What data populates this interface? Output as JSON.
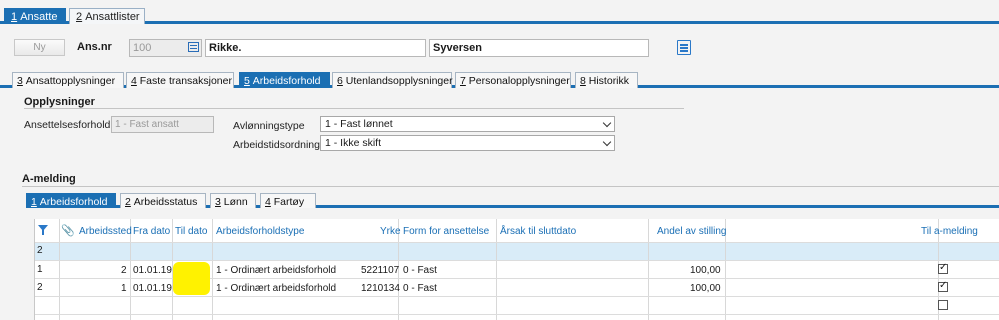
{
  "top_tabs": [
    {
      "key": "1",
      "label": "Ansatte"
    },
    {
      "key": "2",
      "label": "Ansattlister"
    }
  ],
  "header": {
    "new_button": "Ny",
    "ansnr_label": "Ans.nr",
    "ansnr_value": "100",
    "first_name": "Rikke.",
    "last_name": "Syversen"
  },
  "sub_tabs": [
    {
      "key": "3",
      "label": "Ansattopplysninger"
    },
    {
      "key": "4",
      "label": "Faste transaksjoner"
    },
    {
      "key": "5",
      "label": "Arbeidsforhold"
    },
    {
      "key": "6",
      "label": "Utenlandsopplysninger"
    },
    {
      "key": "7",
      "label": "Personalopplysninger"
    },
    {
      "key": "8",
      "label": "Historikk"
    }
  ],
  "opplysninger": {
    "title": "Opplysninger",
    "ansettelsesforhold_label": "Ansettelsesforhold",
    "ansettelsesforhold_value": "1 - Fast ansatt",
    "avlonningstype_label": "Avlønningstype",
    "avlonningstype_value": "1 - Fast lønnet",
    "arbeidstidsordning_label": "Arbeidstidsordning",
    "arbeidstidsordning_value": "1 - Ikke skift"
  },
  "amelding": {
    "title": "A-melding",
    "tabs": [
      {
        "key": "1",
        "label": "Arbeidsforhold"
      },
      {
        "key": "2",
        "label": "Arbeidsstatus"
      },
      {
        "key": "3",
        "label": "Lønn"
      },
      {
        "key": "4",
        "label": "Fartøy"
      }
    ],
    "columns": {
      "arbeidssted": "Arbeidssted",
      "fra_dato": "Fra dato",
      "til_dato": "Til dato",
      "arbeidsforholdstype": "Arbeidsforholdstype",
      "yrke": "Yrke",
      "form": "Form for ansettelse",
      "arsak": "Årsak til sluttdato",
      "andel": "Andel av stilling",
      "til_amelding": "Til a-melding"
    },
    "selected_row_label": "2",
    "rows": [
      {
        "num": "1",
        "arbeidssted": "2",
        "fra_dato": "01.01.19",
        "til_dato": "",
        "type": "1 - Ordinært arbeidsforhold",
        "yrke": "5221107",
        "form": "0 - Fast",
        "arsak": "",
        "andel": "100,00",
        "til_amelding": true
      },
      {
        "num": "2",
        "arbeidssted": "1",
        "fra_dato": "01.01.19",
        "til_dato": "",
        "type": "1 - Ordinært arbeidsforhold",
        "yrke": "1210134",
        "form": "0 - Fast",
        "arsak": "",
        "andel": "100,00",
        "til_amelding": true
      }
    ],
    "empty_row_checked": false,
    "checkmark": "✓"
  },
  "colors": {
    "accent": "#1b6fb3",
    "highlight": "#fff200",
    "selected_row": "#d9ecf8"
  }
}
